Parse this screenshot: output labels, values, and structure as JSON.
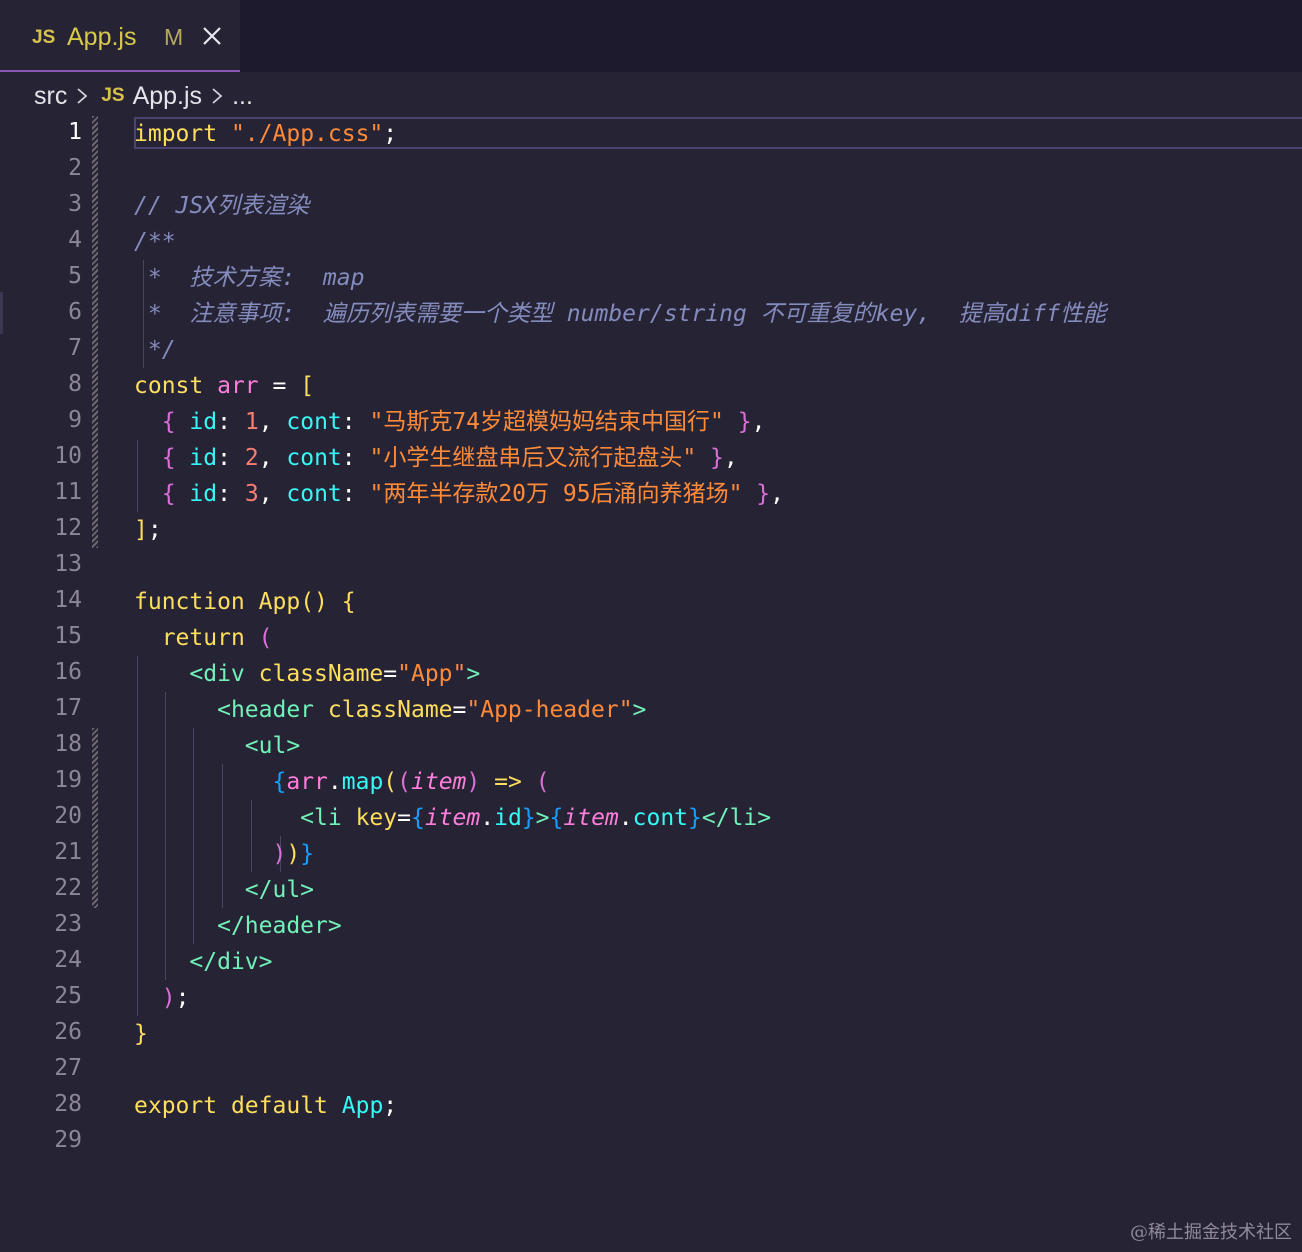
{
  "tab": {
    "icon_label": "JS",
    "filename": "App.js",
    "status": "M",
    "close_icon": "close-icon"
  },
  "breadcrumb": {
    "folder": "src",
    "file_icon_label": "JS",
    "file": "App.js",
    "more": "..."
  },
  "editor": {
    "active_line": 1,
    "lines": [
      {
        "n": "1",
        "tokens": [
          [
            "kw",
            "import"
          ],
          [
            "punc",
            " "
          ],
          [
            "str",
            "\"./App.css\""
          ],
          [
            "punc",
            ";"
          ]
        ]
      },
      {
        "n": "2",
        "tokens": []
      },
      {
        "n": "3",
        "tokens": [
          [
            "cmt",
            "// JSX列表渲染"
          ]
        ]
      },
      {
        "n": "4",
        "tokens": [
          [
            "cmt",
            "/**"
          ]
        ]
      },
      {
        "n": "5",
        "tokens": [
          [
            "cmt",
            " *  技术方案:  map"
          ]
        ]
      },
      {
        "n": "6",
        "tokens": [
          [
            "cmt",
            " *  注意事项:  遍历列表需要一个类型 number/string 不可重复的key,  提高diff性能"
          ]
        ]
      },
      {
        "n": "7",
        "tokens": [
          [
            "cmt",
            " */"
          ]
        ]
      },
      {
        "n": "8",
        "tokens": [
          [
            "kw",
            "const"
          ],
          [
            "punc",
            " "
          ],
          [
            "def",
            "arr"
          ],
          [
            "punc",
            " = "
          ],
          [
            "brk",
            "["
          ]
        ]
      },
      {
        "n": "9",
        "tokens": [
          [
            "punc",
            "  "
          ],
          [
            "brk2",
            "{"
          ],
          [
            "punc",
            " "
          ],
          [
            "prop",
            "id"
          ],
          [
            "punc",
            ": "
          ],
          [
            "num",
            "1"
          ],
          [
            "punc",
            ", "
          ],
          [
            "prop",
            "cont"
          ],
          [
            "punc",
            ": "
          ],
          [
            "str",
            "\"马斯克74岁超模妈妈结束中国行\""
          ],
          [
            "punc",
            " "
          ],
          [
            "brk2",
            "}"
          ],
          [
            "punc",
            ","
          ]
        ]
      },
      {
        "n": "10",
        "tokens": [
          [
            "punc",
            "  "
          ],
          [
            "brk2",
            "{"
          ],
          [
            "punc",
            " "
          ],
          [
            "prop",
            "id"
          ],
          [
            "punc",
            ": "
          ],
          [
            "num",
            "2"
          ],
          [
            "punc",
            ", "
          ],
          [
            "prop",
            "cont"
          ],
          [
            "punc",
            ": "
          ],
          [
            "str",
            "\"小学生继盘串后又流行起盘头\""
          ],
          [
            "punc",
            " "
          ],
          [
            "brk2",
            "}"
          ],
          [
            "punc",
            ","
          ]
        ]
      },
      {
        "n": "11",
        "tokens": [
          [
            "punc",
            "  "
          ],
          [
            "brk2",
            "{"
          ],
          [
            "punc",
            " "
          ],
          [
            "prop",
            "id"
          ],
          [
            "punc",
            ": "
          ],
          [
            "num",
            "3"
          ],
          [
            "punc",
            ", "
          ],
          [
            "prop",
            "cont"
          ],
          [
            "punc",
            ": "
          ],
          [
            "str",
            "\"两年半存款20万 95后涌向养猪场\""
          ],
          [
            "punc",
            " "
          ],
          [
            "brk2",
            "}"
          ],
          [
            "punc",
            ","
          ]
        ]
      },
      {
        "n": "12",
        "tokens": [
          [
            "brk",
            "]"
          ],
          [
            "punc",
            ";"
          ]
        ]
      },
      {
        "n": "13",
        "tokens": []
      },
      {
        "n": "14",
        "tokens": [
          [
            "kw",
            "function"
          ],
          [
            "punc",
            " "
          ],
          [
            "kw",
            "App"
          ],
          [
            "brk",
            "()"
          ],
          [
            "punc",
            " "
          ],
          [
            "brk",
            "{"
          ]
        ]
      },
      {
        "n": "15",
        "tokens": [
          [
            "punc",
            "  "
          ],
          [
            "kw",
            "return"
          ],
          [
            "punc",
            " "
          ],
          [
            "brk2",
            "("
          ]
        ]
      },
      {
        "n": "16",
        "tokens": [
          [
            "punc",
            "    "
          ],
          [
            "tag",
            "<div"
          ],
          [
            "punc",
            " "
          ],
          [
            "attr",
            "className"
          ],
          [
            "punc",
            "="
          ],
          [
            "str",
            "\"App\""
          ],
          [
            "tag",
            ">"
          ]
        ]
      },
      {
        "n": "17",
        "tokens": [
          [
            "punc",
            "      "
          ],
          [
            "tag",
            "<header"
          ],
          [
            "punc",
            " "
          ],
          [
            "attr",
            "className"
          ],
          [
            "punc",
            "="
          ],
          [
            "str",
            "\"App-header\""
          ],
          [
            "tag",
            ">"
          ]
        ]
      },
      {
        "n": "18",
        "tokens": [
          [
            "punc",
            "        "
          ],
          [
            "tag",
            "<ul>"
          ]
        ]
      },
      {
        "n": "19",
        "tokens": [
          [
            "punc",
            "          "
          ],
          [
            "brk3",
            "{"
          ],
          [
            "def",
            "arr"
          ],
          [
            "punc",
            "."
          ],
          [
            "fn",
            "map"
          ],
          [
            "brk",
            "("
          ],
          [
            "brk2",
            "("
          ],
          [
            "it",
            "item"
          ],
          [
            "brk2",
            ")"
          ],
          [
            "punc",
            " "
          ],
          [
            "kw",
            "=>"
          ],
          [
            "punc",
            " "
          ],
          [
            "brk2",
            "("
          ]
        ]
      },
      {
        "n": "20",
        "tokens": [
          [
            "punc",
            "            "
          ],
          [
            "tag",
            "<li"
          ],
          [
            "punc",
            " "
          ],
          [
            "attr",
            "key"
          ],
          [
            "punc",
            "="
          ],
          [
            "brk3",
            "{"
          ],
          [
            "it",
            "item"
          ],
          [
            "punc",
            "."
          ],
          [
            "prop",
            "id"
          ],
          [
            "brk3",
            "}"
          ],
          [
            "tag",
            ">"
          ],
          [
            "brk3",
            "{"
          ],
          [
            "it",
            "item"
          ],
          [
            "punc",
            "."
          ],
          [
            "prop",
            "cont"
          ],
          [
            "brk3",
            "}"
          ],
          [
            "tag",
            "</li>"
          ]
        ]
      },
      {
        "n": "21",
        "tokens": [
          [
            "punc",
            "          "
          ],
          [
            "brk2",
            ")"
          ],
          [
            "brk",
            ")"
          ],
          [
            "brk3",
            "}"
          ]
        ]
      },
      {
        "n": "22",
        "tokens": [
          [
            "punc",
            "        "
          ],
          [
            "tag",
            "</ul>"
          ]
        ]
      },
      {
        "n": "23",
        "tokens": [
          [
            "punc",
            "      "
          ],
          [
            "tag",
            "</header>"
          ]
        ]
      },
      {
        "n": "24",
        "tokens": [
          [
            "punc",
            "    "
          ],
          [
            "tag",
            "</div>"
          ]
        ]
      },
      {
        "n": "25",
        "tokens": [
          [
            "punc",
            "  "
          ],
          [
            "brk2",
            ")"
          ],
          [
            "punc",
            ";"
          ]
        ]
      },
      {
        "n": "26",
        "tokens": [
          [
            "brk",
            "}"
          ]
        ]
      },
      {
        "n": "27",
        "tokens": []
      },
      {
        "n": "28",
        "tokens": [
          [
            "kw",
            "export"
          ],
          [
            "punc",
            " "
          ],
          [
            "kw",
            "default"
          ],
          [
            "punc",
            " "
          ],
          [
            "fn",
            "App"
          ],
          [
            "punc",
            ";"
          ]
        ]
      },
      {
        "n": "29",
        "tokens": []
      }
    ]
  },
  "watermark": "@稀土掘金技术社区"
}
